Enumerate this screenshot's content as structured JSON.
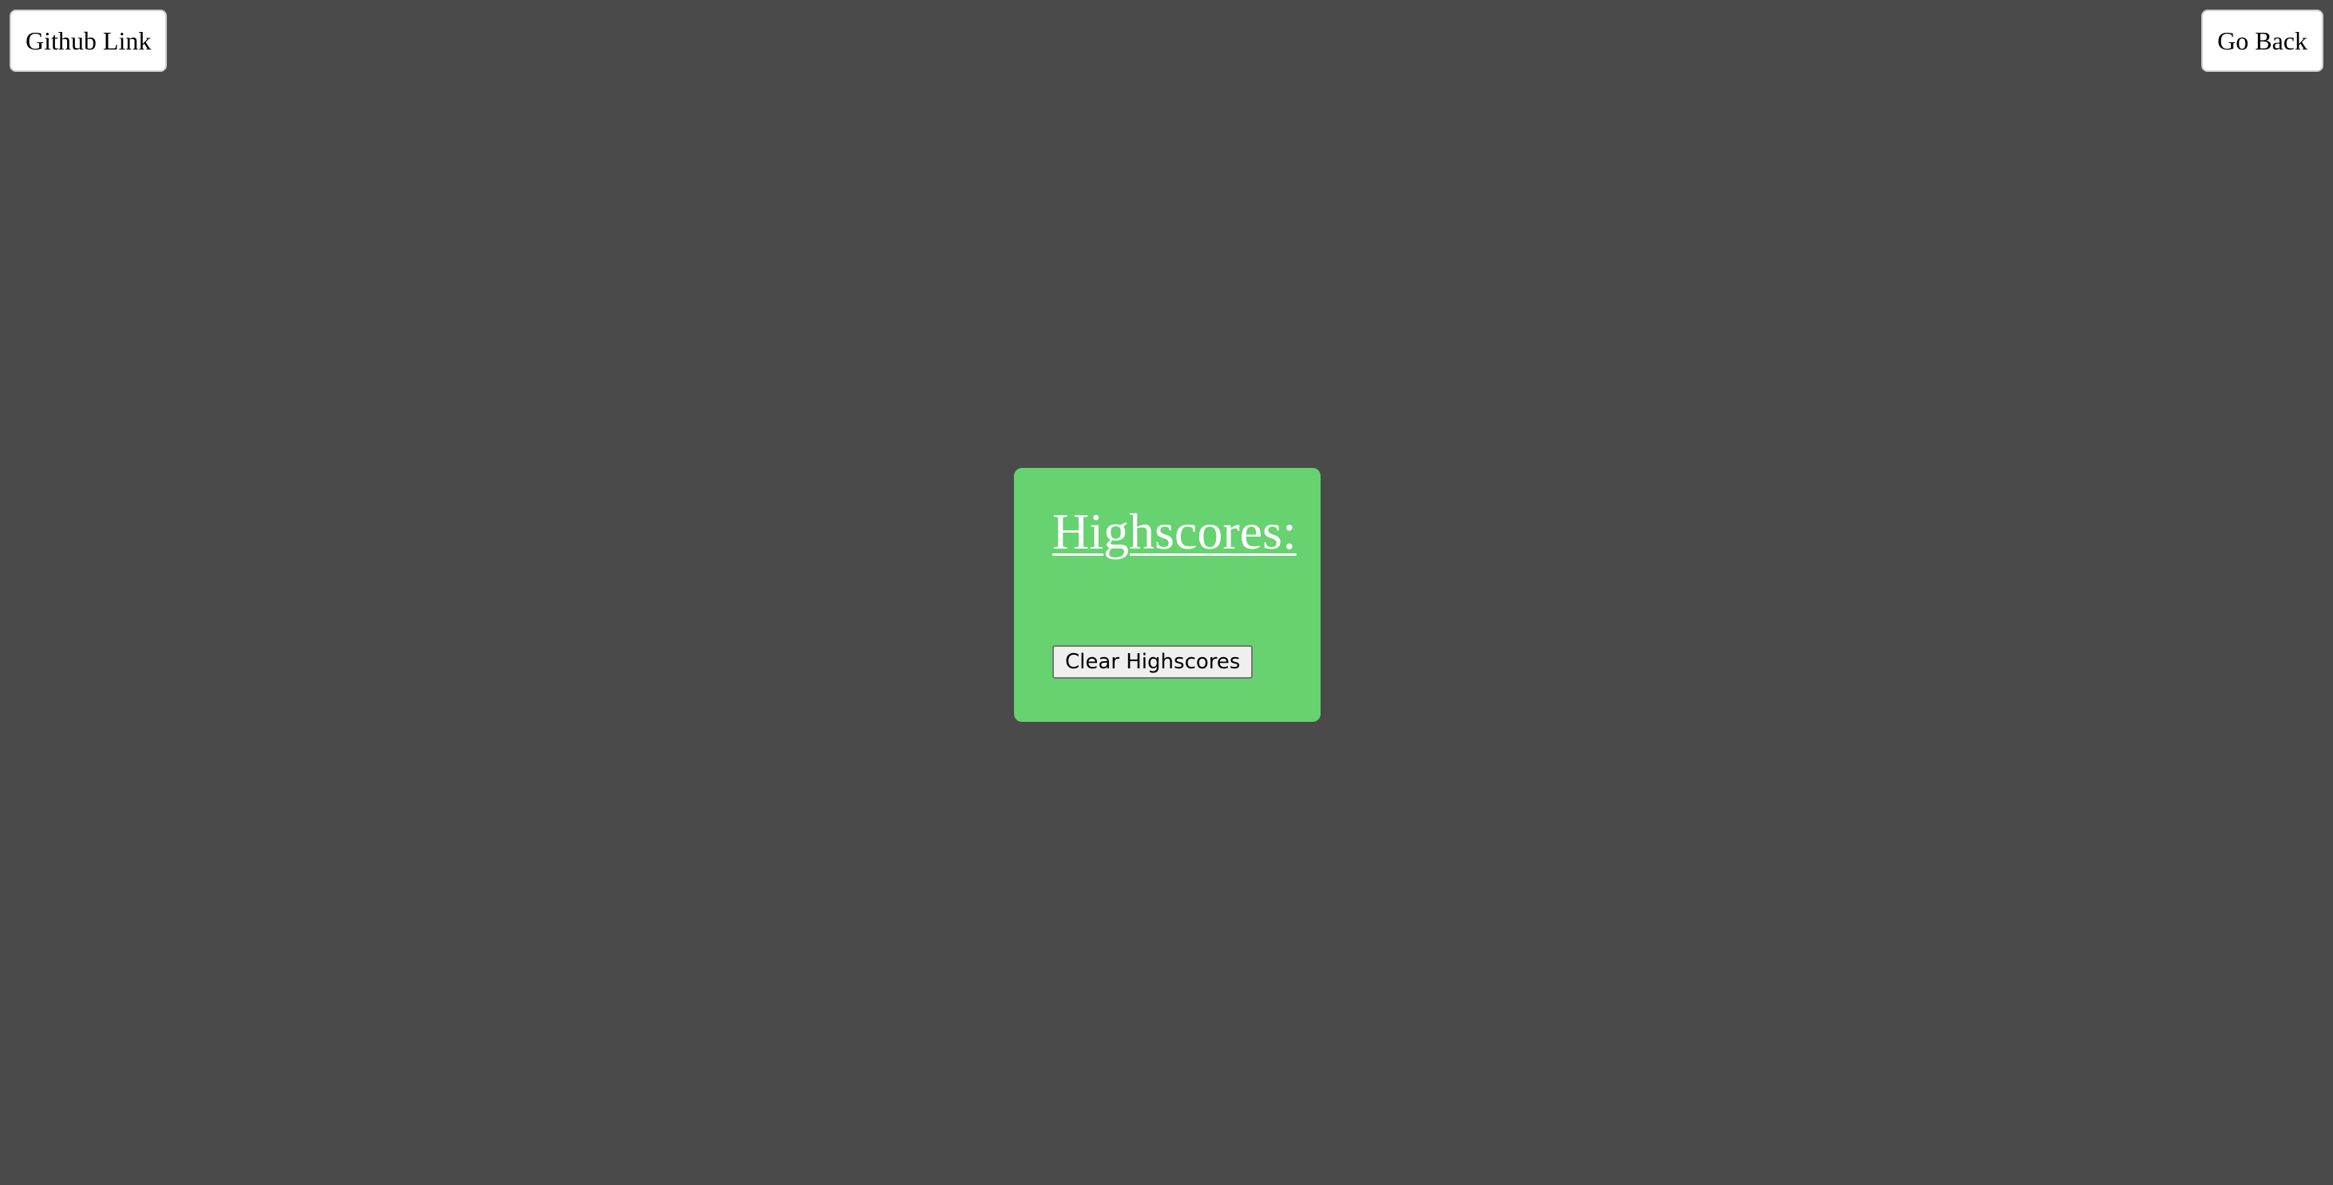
{
  "header": {
    "github_link_label": "Github Link",
    "go_back_label": "Go Back"
  },
  "highscores_card": {
    "title": "Highscores:",
    "entries": [],
    "clear_button_label": "Clear Highscores"
  },
  "colors": {
    "page_background": "#4a4a4a",
    "card_background": "#67d270",
    "title_text": "#ffffff",
    "link_background": "#ffffff"
  }
}
